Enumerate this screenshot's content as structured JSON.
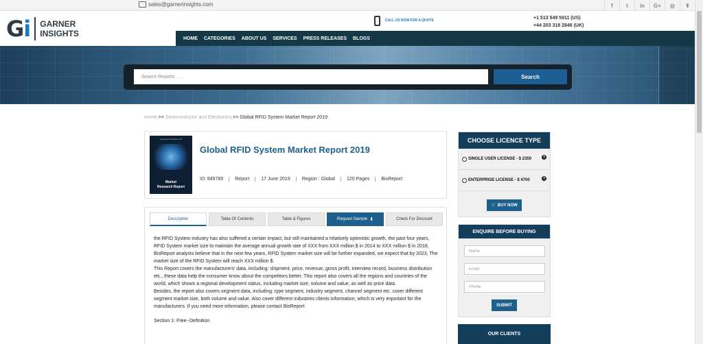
{
  "topbar": {
    "email": "sales@garnerinsights.com",
    "social": [
      "f",
      "t",
      "in",
      "G+",
      "◎",
      "⬆"
    ]
  },
  "logo": {
    "mark_g": "G",
    "mark_i": "i",
    "line1": "GARNER",
    "line2": "INSIGHTS"
  },
  "header": {
    "call_text": "CALL US NOW FOR A QUOTE",
    "phone_us": "+1   513 549 5911 (US)",
    "phone_uk": "+44 203 318 2846 (UK)"
  },
  "nav": [
    "HOME",
    "CATEGORIES",
    "ABOUT US",
    "SERVICES",
    "PRESS RELEASES",
    "BLOGS"
  ],
  "search": {
    "placeholder": "Search Reports . . .",
    "button": "Search"
  },
  "breadcrumb": {
    "home": "Home",
    "sep1": ">>",
    "category": "Semiconductor and Electronics",
    "sep2": ">>",
    "current": "Global RFID System Market Report 2019"
  },
  "product": {
    "cover_top": "www.garnerinsights.com",
    "cover_line1": "Market",
    "cover_line2": "Research Report",
    "title": "Global RFID System Market Report 2019",
    "meta": [
      "ID: 849785",
      "Report",
      "17 June 2019",
      "Region : Global",
      "120 Pages",
      "BisReport"
    ]
  },
  "tabs": {
    "description": "Description",
    "toc": "Table Of Contents",
    "figures": "Table & Figures",
    "request": "Request Sample",
    "discount": "Check For Discount"
  },
  "description": {
    "p1": "the RFID System industry has also suffered a certain impact, but still maintained a relatively optimistic growth, the past four years, RFID System market size to maintain the average annual growth rate of XXX from XXX million $ in 2014 to XXX million $ in 2018, BisReport analysts believe that in the next few years, RFID System market size will be further expanded, we expect that by 2023, The market size of the RFID System will reach XXX million $.",
    "p2": "This Report covers the manufacturers' data, including: shipment, price, revenue, gross profit, interview record, business distribution etc., these data help the consumer know about the competitors better. This report also covers all the regions and countries of the world, which shows a regional development status, including market size, volume and value, as well as price data.",
    "p3": "Besides, the report also covers segment data, including: type segment, industry segment, channel segment etc. cover different segment market size, both volume and value. Also cover different industries clients information, which is very important for the manufacturers. If you need more information, please contact BisReport",
    "section": "Section 1: Free--Definition"
  },
  "licence": {
    "title": "CHOOSE LICENCE TYPE",
    "single": "SINGLE USER LICENSE - $ 2350",
    "enterprise": "ENTERPRISE LICENSE - $ 4700",
    "help": "?",
    "buy": "BUY NOW"
  },
  "enquire": {
    "title": "ENQUIRE BEFORE BUYING",
    "name_placeholder": "Name",
    "email_placeholder": "Email",
    "phone_placeholder": "Phone",
    "submit": "SUBMIT"
  },
  "clients": {
    "title": "OUR CLIENTS"
  }
}
